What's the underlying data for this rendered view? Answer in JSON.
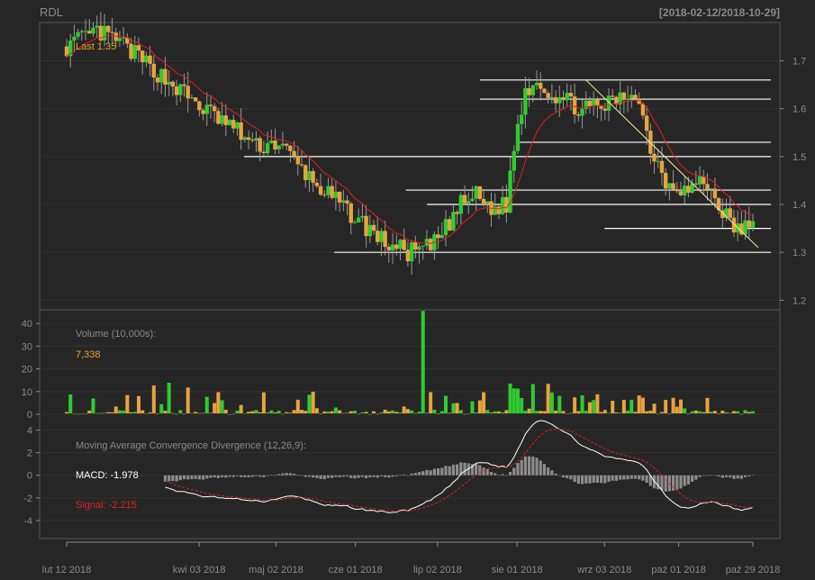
{
  "header": {
    "symbol": "RDL",
    "range": "[2018-02-12/2018-10-29]"
  },
  "colors": {
    "background": "#262626",
    "up": "#2fcc2f",
    "down": "#e8a33d",
    "text": "#8a8a8a",
    "orange_text": "#f0a030",
    "red": "#e02020",
    "white": "#ffffff",
    "hist": "#8c8c8c",
    "trend": "#f5f0a0"
  },
  "chart_data": [
    {
      "type": "candlestick",
      "panel": "price",
      "ylim": [
        1.18,
        1.78
      ],
      "y_ticks": [
        "1.7",
        "1.6",
        "1.5",
        "1.4",
        "1.3",
        "1.2"
      ],
      "annotation": "Last 1.35",
      "x_labels": [
        "lut 12 2018",
        "kwi 03 2018",
        "maj 02 2018",
        "cze 01 2018",
        "lip 02 2018",
        "sie 01 2018",
        "wrz 03 2018",
        "paź 01 2018",
        "paź 29 2018"
      ],
      "support_resistance": [
        {
          "value": 1.66,
          "from": "2018-07-18",
          "to": "2018-10-29"
        },
        {
          "value": 1.62,
          "from": "2018-07-18",
          "to": "2018-10-29"
        },
        {
          "value": 1.53,
          "from": "2018-08-01",
          "to": "2018-10-29"
        },
        {
          "value": 1.5,
          "from": "2018-04-20",
          "to": "2018-10-29"
        },
        {
          "value": 1.43,
          "from": "2018-06-20",
          "to": "2018-10-29"
        },
        {
          "value": 1.4,
          "from": "2018-06-28",
          "to": "2018-10-29"
        },
        {
          "value": 1.35,
          "from": "2018-09-03",
          "to": "2018-10-29"
        },
        {
          "value": 1.3,
          "from": "2018-05-24",
          "to": "2018-10-29"
        }
      ],
      "trendline": {
        "from": [
          "2018-08-27",
          1.66
        ],
        "to": [
          "2018-10-31",
          1.31
        ]
      }
    },
    {
      "type": "bar",
      "panel": "volume",
      "label": "Volume (10,000s):",
      "last_value": "7,338",
      "ylim": [
        0,
        46
      ],
      "y_ticks": [
        "40",
        "30",
        "20",
        "10",
        "0"
      ]
    },
    {
      "type": "line",
      "panel": "macd",
      "label": "Moving Average Convergence Divergence (12,26,9):",
      "macd_label": "MACD: -1.978",
      "signal_label": "Signal: -2.215",
      "ylim": [
        -5.6,
        5.4
      ],
      "y_ticks": [
        "4",
        "2",
        "0",
        "-2",
        "-4"
      ]
    }
  ]
}
